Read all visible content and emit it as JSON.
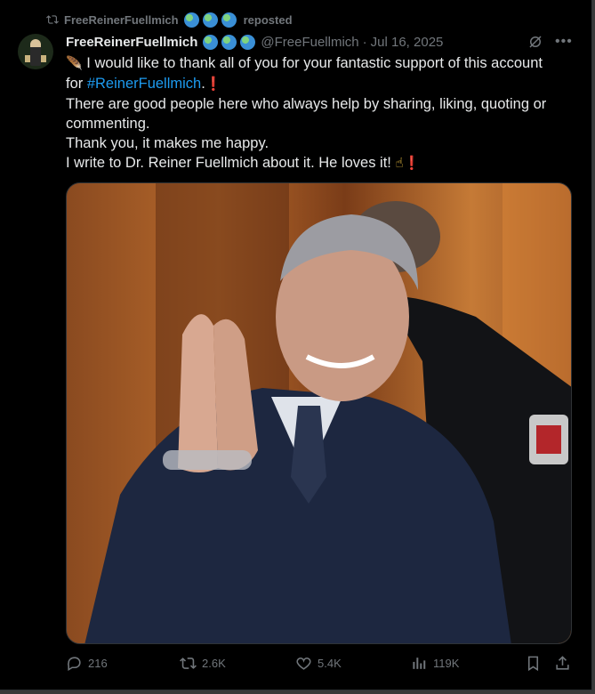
{
  "repost": {
    "name": "FreeReinerFuellmich",
    "suffix": "reposted"
  },
  "post": {
    "author_name": "FreeReinerFuellmich",
    "handle": "@FreeFuellmich",
    "separator": "·",
    "date": "Jul 16, 2025",
    "line1": "I would like to thank all of you for your fantastic support of this account",
    "line2_prefix": "for ",
    "hashtag": "#ReinerFuellmich",
    "line2_suffix": ".",
    "line3": "There are good people here who always help by sharing, liking, quoting or",
    "line4": "commenting.",
    "line5": "Thank you, it makes me happy.",
    "line6": "I write to Dr. Reiner Fuellmich about it. He loves it!"
  },
  "emoji": {
    "quill": "🪶",
    "exclaim": "❗",
    "point": "☝"
  },
  "actions": {
    "replies": "216",
    "reposts": "2.6K",
    "likes": "5.4K",
    "views": "119K"
  },
  "colors": {
    "background": "#000000",
    "text": "#e7e9ea",
    "muted": "#71767b",
    "link": "#1d9bf0"
  },
  "icons": [
    "repost-icon",
    "grok-icon",
    "more-icon",
    "reply-icon",
    "like-icon",
    "views-icon",
    "bookmark-icon",
    "share-icon"
  ]
}
